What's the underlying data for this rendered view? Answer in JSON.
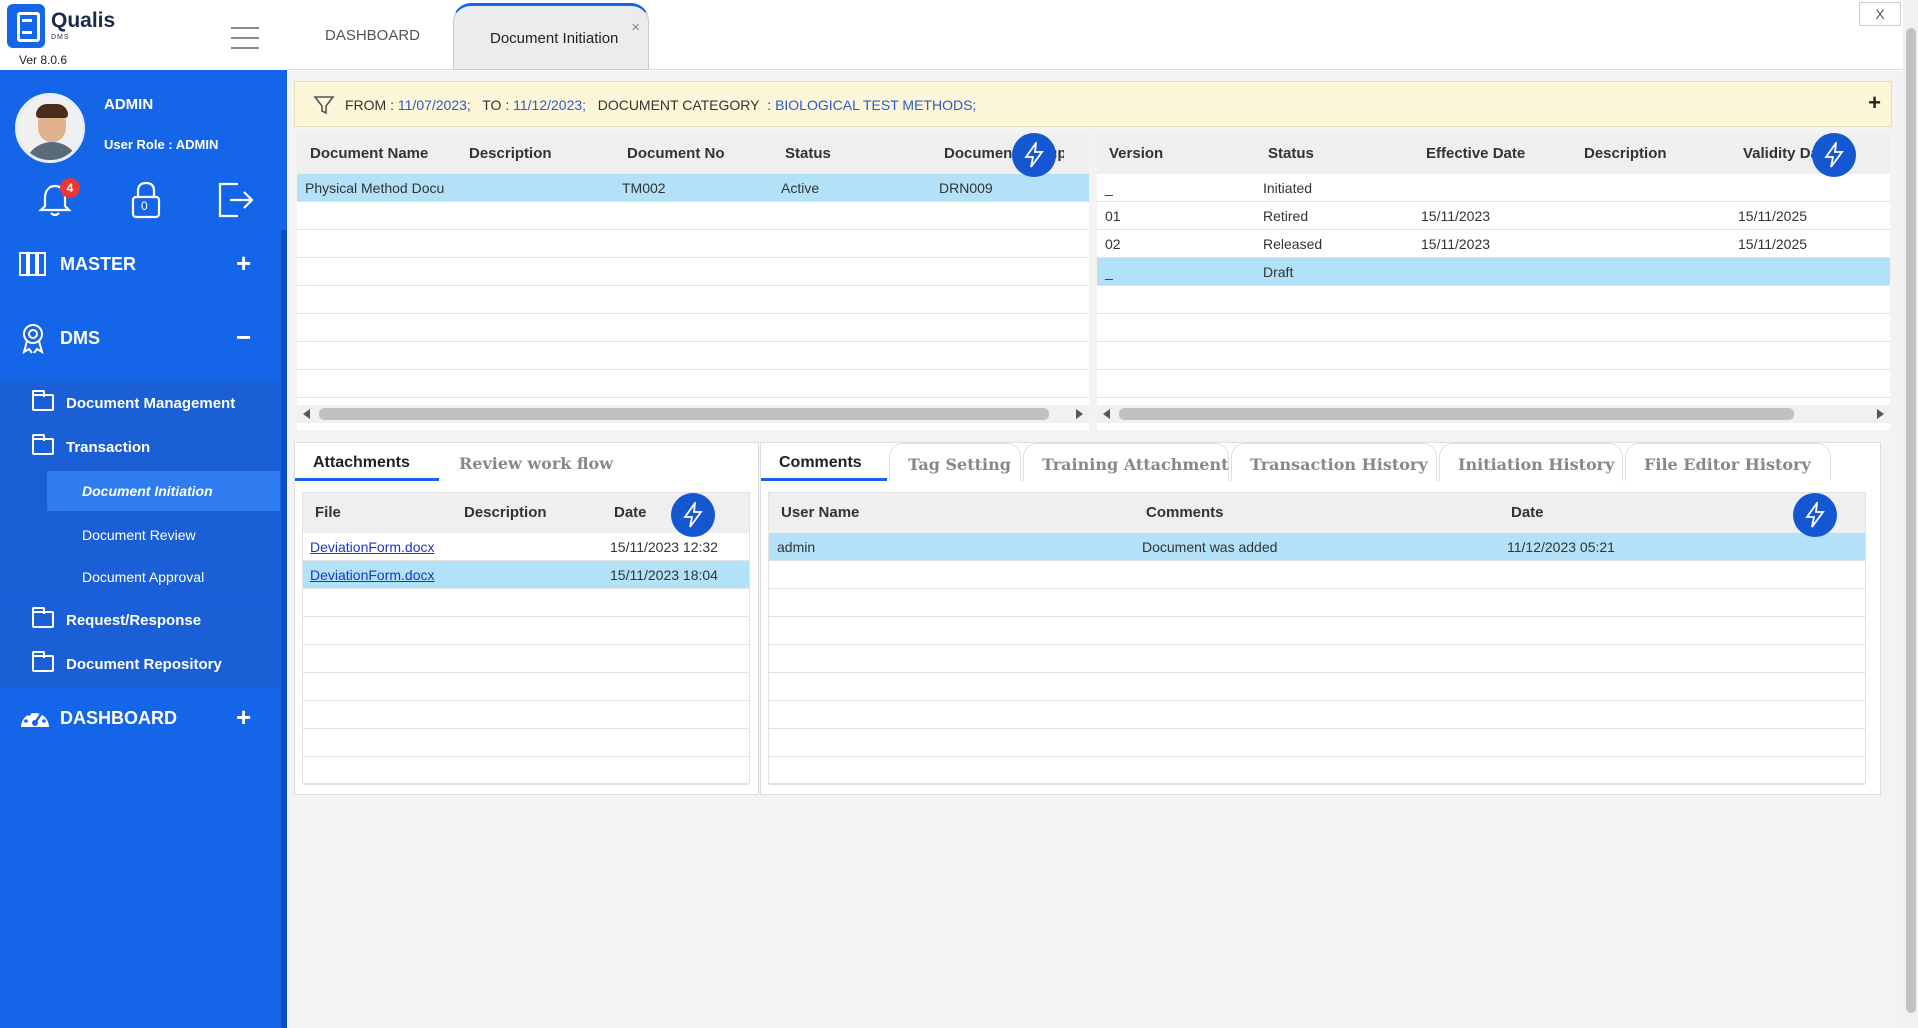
{
  "app": {
    "name": "Qualis",
    "sub": "DMS",
    "version": "Ver 8.0.6"
  },
  "user": {
    "name": "ADMIN",
    "role": "User Role : ADMIN",
    "notifications": "4",
    "locks": "0"
  },
  "nav": {
    "master": "MASTER",
    "dms": "DMS",
    "document_management": "Document Management",
    "transaction": "Transaction",
    "document_initiation": "Document Initiation",
    "document_review": "Document Review",
    "document_approval": "Document Approval",
    "request_response": "Request/Response",
    "document_repository": "Document Repository",
    "dashboard": "DASHBOARD",
    "plus": "+",
    "minus": "−"
  },
  "tabs": {
    "dashboard": "DASHBOARD",
    "document_initiation": "Document Initiation",
    "close": "×",
    "window_close": "X"
  },
  "filter": {
    "from_label": "FROM",
    "from_value": "11/07/2023;",
    "to_label": "TO",
    "to_value": "11/12/2023;",
    "category_label": "DOCUMENT CATEGORY",
    "category_value": "BIOLOGICAL TEST METHODS;",
    "sep": ":",
    "plus": "+"
  },
  "documents": {
    "columns": [
      "Document Name",
      "Description",
      "Document No",
      "Status",
      "Document Group"
    ],
    "rows": [
      {
        "name": "Physical Method Docu",
        "description": "",
        "no": "TM002",
        "status": "Active",
        "group": "DRN009"
      }
    ]
  },
  "versions": {
    "columns": [
      "Version",
      "Status",
      "Effective Date",
      "Description",
      "Validity Date"
    ],
    "rows": [
      {
        "version": "_",
        "status": "Initiated",
        "effective": "",
        "description": "",
        "validity": ""
      },
      {
        "version": "01",
        "status": "Retired",
        "effective": "15/11/2023",
        "description": "",
        "validity": "15/11/2025"
      },
      {
        "version": "02",
        "status": "Released",
        "effective": "15/11/2023",
        "description": "",
        "validity": "15/11/2025"
      },
      {
        "version": "_",
        "status": "Draft",
        "effective": "",
        "description": "",
        "validity": ""
      }
    ]
  },
  "left_tabs": {
    "attachments": "Attachments",
    "review": "Review work flow"
  },
  "attachments": {
    "columns": [
      "File",
      "Description",
      "Date"
    ],
    "rows": [
      {
        "file": "DeviationForm.docx",
        "description": "",
        "date": "15/11/2023 12:32"
      },
      {
        "file": "DeviationForm.docx",
        "description": "",
        "date": "15/11/2023 18:04"
      }
    ]
  },
  "right_tabs": {
    "comments": "Comments",
    "tag_setting": "Tag Setting",
    "training": "Training Attachment",
    "transaction_history": "Transaction History",
    "initiation_history": "Initiation History",
    "file_editor_history": "File Editor History"
  },
  "comments": {
    "columns": [
      "User Name",
      "Comments",
      "Date"
    ],
    "rows": [
      {
        "user": "admin",
        "comment": "Document was added",
        "date": "11/12/2023 05:21"
      }
    ]
  },
  "colors": {
    "sidebar": "#1565e8",
    "accent": "#1557d0",
    "selected_row": "#b3e2f8",
    "filter_bg": "#fdf6d8"
  }
}
